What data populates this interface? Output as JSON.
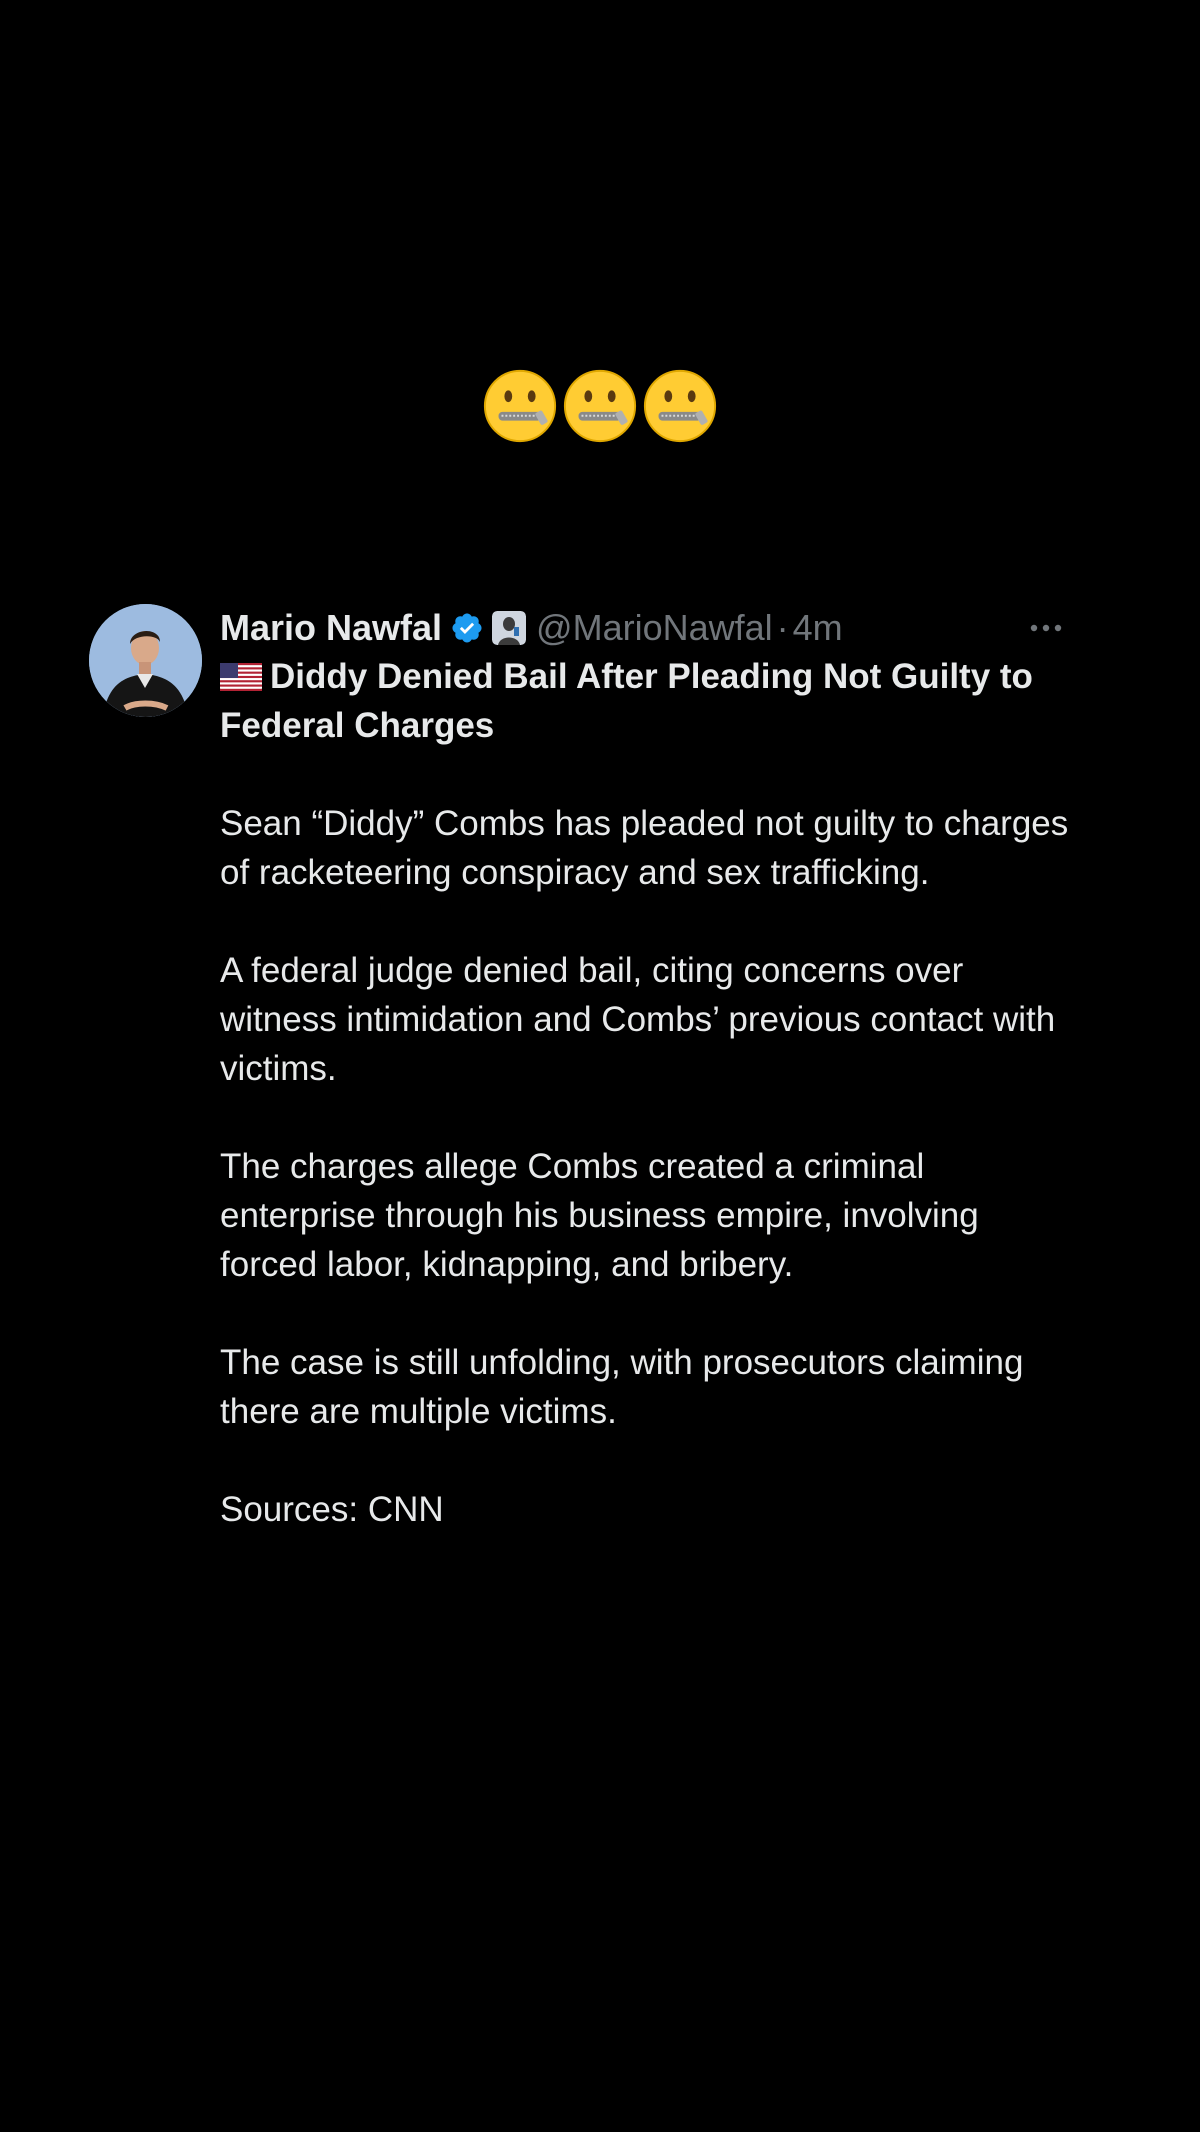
{
  "caption": {
    "emojis": [
      "zipper-mouth-face-emoji",
      "zipper-mouth-face-emoji",
      "zipper-mouth-face-emoji"
    ]
  },
  "tweet": {
    "author_name": "Mario Nawfal",
    "handle": "@MarioNawfal",
    "separator": "·",
    "time": "4m",
    "verified_color": "#1d9bf0",
    "title_flag": "us-flag-emoji",
    "title": "Diddy Denied Bail After Pleading Not Guilty to Federal Charges",
    "paragraphs": [
      "Sean “Diddy” Combs has pleaded not guilty to charges of racketeering conspiracy and sex trafficking.",
      "A federal judge denied bail, citing concerns over witness intimidation and Combs’ previous contact with victims.",
      "The charges allege Combs created a criminal enterprise through his business empire, involving forced labor, kidnapping, and bribery.",
      "The case is still unfolding, with prosecutors claiming there are multiple victims.",
      "Sources: CNN"
    ]
  },
  "colors": {
    "background": "#000000",
    "text": "#e7e9ea",
    "muted": "#71767b"
  }
}
